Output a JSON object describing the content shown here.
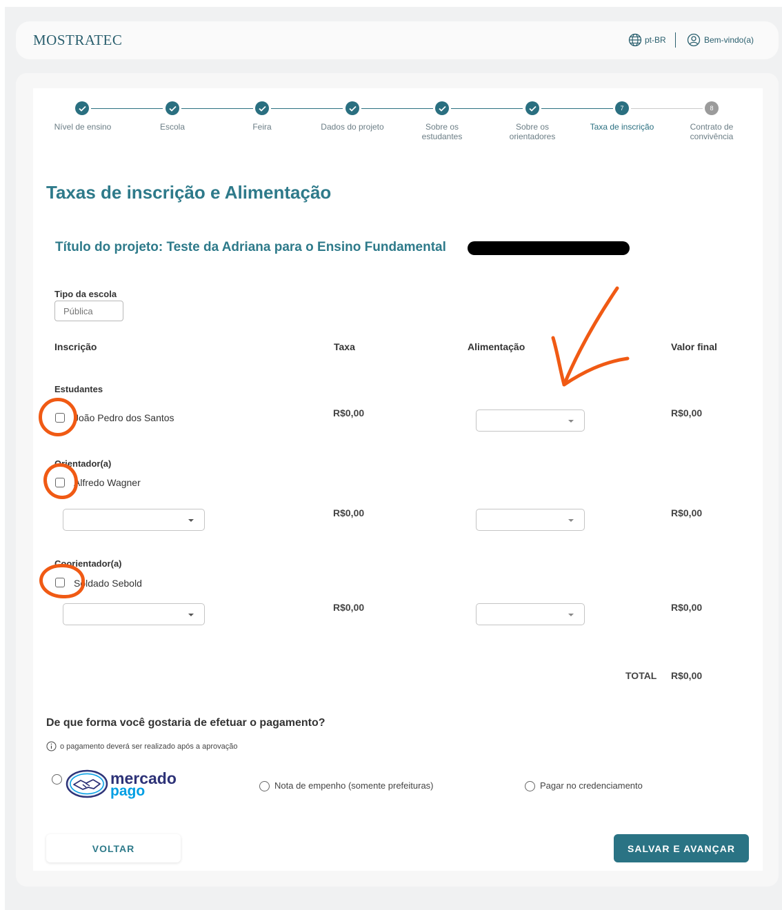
{
  "header": {
    "logo": "MOSTRATEC",
    "language": "pt-BR",
    "welcome": "Bem-vindo(a)"
  },
  "stepper": {
    "steps": [
      {
        "label": "Nível de ensino",
        "state": "done"
      },
      {
        "label": "Escola",
        "state": "done"
      },
      {
        "label": "Feira",
        "state": "done"
      },
      {
        "label": "Dados do projeto",
        "state": "done"
      },
      {
        "label": "Sobre os estudantes",
        "state": "done"
      },
      {
        "label": "Sobre os orientadores",
        "state": "done"
      },
      {
        "label": "Taxa de inscrição",
        "state": "current",
        "number": "7"
      },
      {
        "label": "Contrato de convivência",
        "state": "pending",
        "number": "8"
      }
    ]
  },
  "page": {
    "title": "Taxas de inscrição e Alimentação",
    "project_title": "Título do projeto: Teste da Adriana para o Ensino Fundamental"
  },
  "school": {
    "label": "Tipo da escola",
    "placeholder": "Pública"
  },
  "table": {
    "headers": {
      "inscricao": "Inscrição",
      "taxa": "Taxa",
      "alimentacao": "Alimentação",
      "valor_final": "Valor final"
    },
    "groups": [
      {
        "title": "Estudantes",
        "person": "João Pedro dos Santos",
        "taxa": "R$0,00",
        "valor_final": "R$0,00"
      },
      {
        "title": "Orientador(a)",
        "person": "Alfredo Wagner",
        "taxa": "R$0,00",
        "valor_final": "R$0,00"
      },
      {
        "title": "Coorientador(a)",
        "person": "Soldado Sebold",
        "taxa": "R$0,00",
        "valor_final": "R$0,00"
      }
    ],
    "total_label": "TOTAL",
    "total_value": "R$0,00"
  },
  "payment": {
    "question": "De que forma você gostaria de efetuar o pagamento?",
    "info": "o pagamento deverá ser realizado após a aprovação",
    "options": {
      "mercado_pago_line1": "mercado",
      "mercado_pago_line2": "pago",
      "empenho": "Nota de empenho (somente prefeituras)",
      "credenciamento": "Pagar no credenciamento"
    }
  },
  "buttons": {
    "back": "VOLTAR",
    "next": "SALVAR E AVANÇAR"
  },
  "colors": {
    "primary": "#2a7384",
    "annotation": "#f05a14"
  }
}
